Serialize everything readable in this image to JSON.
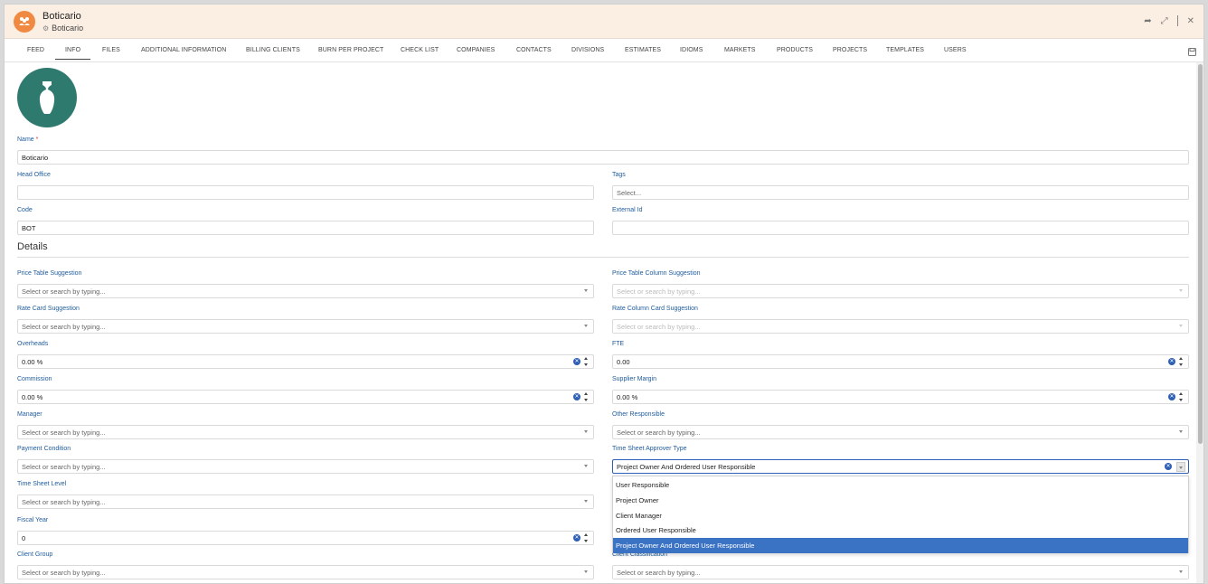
{
  "window": {
    "title": "Boticario",
    "subtitle": "Boticario"
  },
  "tabs": [
    {
      "label": "FEED",
      "active": false
    },
    {
      "label": "INFO",
      "active": true
    },
    {
      "label": "FILES",
      "active": false
    },
    {
      "label": "ADDITIONAL INFORMATION",
      "active": false
    },
    {
      "label": "BILLING CLIENTS",
      "active": false
    },
    {
      "label": "BURN PER PROJECT",
      "active": false
    },
    {
      "label": "CHECK LIST",
      "active": false
    },
    {
      "label": "COMPANIES",
      "active": false
    },
    {
      "label": "CONTACTS",
      "active": false
    },
    {
      "label": "DIVISIONS",
      "active": false
    },
    {
      "label": "ESTIMATES",
      "active": false
    },
    {
      "label": "IDIOMS",
      "active": false
    },
    {
      "label": "MARKETS",
      "active": false
    },
    {
      "label": "PRODUCTS",
      "active": false
    },
    {
      "label": "PROJECTS",
      "active": false
    },
    {
      "label": "TEMPLATES",
      "active": false
    },
    {
      "label": "USERS",
      "active": false
    }
  ],
  "form": {
    "name": {
      "label": "Name",
      "required": "*",
      "value": "Boticario"
    },
    "head_office": {
      "label": "Head Office",
      "value": ""
    },
    "tags": {
      "label": "Tags",
      "placeholder": "Select..."
    },
    "code": {
      "label": "Code",
      "value": "BOT"
    },
    "external_id": {
      "label": "External Id",
      "value": ""
    }
  },
  "details": {
    "section_title": "Details",
    "price_table_suggestion": {
      "label": "Price Table Suggestion",
      "placeholder": "Select or search by typing..."
    },
    "price_table_column_suggestion": {
      "label": "Price Table Column Suggestion",
      "placeholder": "Select or search by typing..."
    },
    "rate_card_suggestion": {
      "label": "Rate Card Suggestion",
      "placeholder": "Select or search by typing..."
    },
    "rate_column_card_suggestion": {
      "label": "Rate Column Card Suggestion",
      "placeholder": "Select or search by typing..."
    },
    "overheads": {
      "label": "Overheads",
      "value": "0.00 %"
    },
    "fte": {
      "label": "FTE",
      "value": "0.00"
    },
    "commission": {
      "label": "Commission",
      "value": "0.00 %"
    },
    "supplier_margin": {
      "label": "Supplier Margin",
      "value": "0.00 %"
    },
    "manager": {
      "label": "Manager",
      "placeholder": "Select or search by typing..."
    },
    "other_responsible": {
      "label": "Other Responsible",
      "placeholder": "Select or search by typing..."
    },
    "payment_condition": {
      "label": "Payment Condition",
      "placeholder": "Select or search by typing..."
    },
    "time_sheet_approver_type": {
      "label": "Time Sheet Approver Type",
      "value": "Project Owner And Ordered User Responsible"
    },
    "time_sheet_level": {
      "label": "Time Sheet Level",
      "placeholder": "Select or search by typing..."
    },
    "fiscal_year": {
      "label": "Fiscal Year",
      "value": "0"
    },
    "client_group": {
      "label": "Client Group",
      "placeholder": "Select or search by typing..."
    },
    "client_classification": {
      "label": "Client Classification",
      "placeholder": "Select or search by typing..."
    }
  },
  "approver_options": [
    {
      "label": "User Responsible",
      "selected": false
    },
    {
      "label": "Project Owner",
      "selected": false
    },
    {
      "label": "Client Manager",
      "selected": false
    },
    {
      "label": "Ordered User Responsible",
      "selected": false
    },
    {
      "label": "Project Owner And Ordered User Responsible",
      "selected": true
    }
  ],
  "colors": {
    "titlebar": "#fbeee3",
    "accent_orange": "#f08a43",
    "label_blue": "#1f5c9c",
    "selected_option": "#3a72c4",
    "avatar": "#2f7a6f"
  },
  "icons": {
    "app": "group-icon",
    "subtitle": "group-icon",
    "share": "share-icon",
    "expand": "expand-icon",
    "close": "close-icon",
    "save": "save-icon",
    "avatar": "vase-icon"
  }
}
